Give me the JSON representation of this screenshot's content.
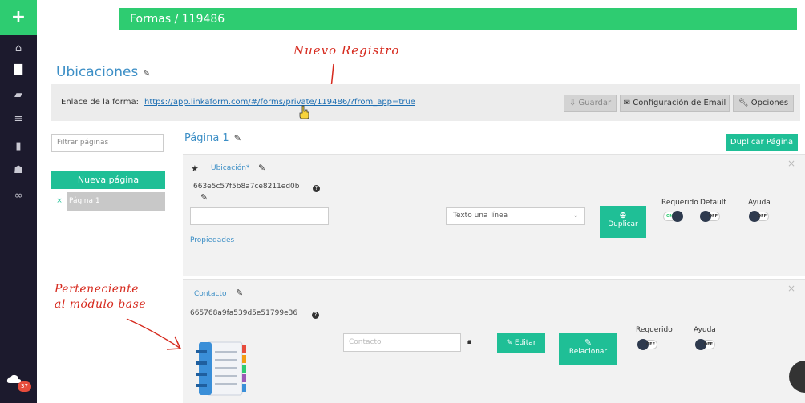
{
  "sidebar": {
    "add_icon": "+",
    "items": [
      {
        "name": "home-icon",
        "glyph": "⌂"
      },
      {
        "name": "document-icon",
        "glyph": "▇"
      },
      {
        "name": "book-icon",
        "glyph": "▰"
      },
      {
        "name": "list-icon",
        "glyph": "≡"
      },
      {
        "name": "chart-icon",
        "glyph": "▮"
      },
      {
        "name": "users-icon",
        "glyph": "☗"
      },
      {
        "name": "link-icon",
        "glyph": "∞"
      }
    ],
    "notifications_count": "37"
  },
  "header": {
    "title": "Formas / 119486"
  },
  "annotations": {
    "nuevo_registro": "Nuevo Registro",
    "perteneciente_line1": "Perteneciente",
    "perteneciente_line2": "al módulo base"
  },
  "form": {
    "title": "Ubicaciones",
    "link_label": "Enlace de la forma:",
    "link_url": "https://app.linkaform.com/#/forms/private/119486/?from_app=true",
    "buttons": {
      "save": "Guardar",
      "email_config": "Configuración de Email",
      "options": "Opciones"
    }
  },
  "pages": {
    "filter_placeholder": "Filtrar páginas",
    "new_page": "Nueva página",
    "items": [
      {
        "remove": "×",
        "label": "Página 1"
      }
    ]
  },
  "page": {
    "title": "Página 1",
    "duplicate_page": "Duplicar Página"
  },
  "fields": [
    {
      "title": "Ubicación*",
      "id": "663e5c57f5b8a7ce8211ed0b",
      "type": "Texto una línea",
      "duplicate": "Duplicar",
      "properties": "Propiedades",
      "required_label": "Requerido",
      "default_label": "Default",
      "help_label": "Ayuda",
      "required_state": "ON",
      "default_state": "OFF",
      "help_state": "OFF"
    },
    {
      "title": "Contacto",
      "id": "665768a9fa539d5e51799e36",
      "placeholder": "Contacto",
      "edit": "Editar",
      "relate": "Relacionar",
      "required_label": "Requerido",
      "help_label": "Ayuda",
      "required_state": "OFF",
      "help_state": "OFF"
    }
  ],
  "colors": {
    "sidebar": "#1c1a2d",
    "accent_green": "#2ecc71",
    "teal": "#1fbf96",
    "link_blue": "#3d8fc6",
    "annotation_red": "#d62a1e"
  }
}
